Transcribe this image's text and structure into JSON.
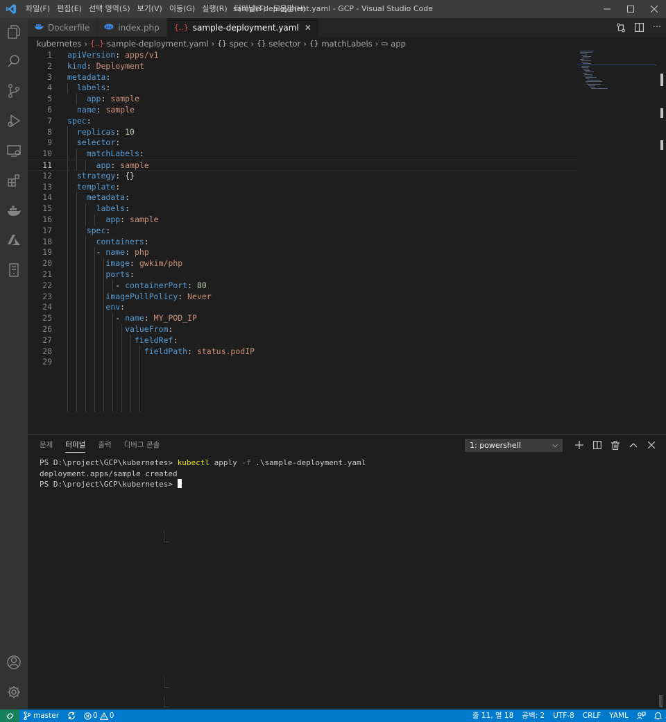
{
  "titlebar": {
    "menu": [
      "파일(F)",
      "편집(E)",
      "선택 영역(S)",
      "보기(V)",
      "이동(G)",
      "실행(R)",
      "터미널(T)",
      "도움말(H)"
    ],
    "title": "sample-deployment.yaml - GCP - Visual Studio Code"
  },
  "tabs": [
    {
      "label": "Dockerfile",
      "icon": "docker-icon",
      "active": false
    },
    {
      "label": "index.php",
      "icon": "php-icon",
      "active": false
    },
    {
      "label": "sample-deployment.yaml",
      "icon": "yaml-icon",
      "active": true
    }
  ],
  "breadcrumb": [
    "kubernetes",
    "sample-deployment.yaml",
    "spec",
    "selector",
    "matchLabels",
    "app"
  ],
  "editor": {
    "current_line": 11,
    "lines": [
      "1",
      "2",
      "3",
      "4",
      "5",
      "6",
      "7",
      "8",
      "9",
      "10",
      "11",
      "12",
      "13",
      "14",
      "15",
      "16",
      "17",
      "18",
      "19",
      "20",
      "21",
      "22",
      "23",
      "24",
      "25",
      "26",
      "27",
      "28",
      "29"
    ],
    "code": {
      "l1": {
        "key": "apiVersion",
        "val": "apps/v1"
      },
      "l2": {
        "key": "kind",
        "val": "Deployment"
      },
      "l3": {
        "key": "metadata"
      },
      "l4": {
        "key": "labels"
      },
      "l5": {
        "key": "app",
        "val": "sample"
      },
      "l6": {
        "key": "name",
        "val": "sample"
      },
      "l7": {
        "key": "spec"
      },
      "l8": {
        "key": "replicas",
        "val": "10"
      },
      "l9": {
        "key": "selector"
      },
      "l10": {
        "key": "matchLabels"
      },
      "l11": {
        "key": "app",
        "val": "sample"
      },
      "l12": {
        "key": "strategy",
        "val": "{}"
      },
      "l13": {
        "key": "template"
      },
      "l14": {
        "key": "metadata"
      },
      "l15": {
        "key": "labels"
      },
      "l16": {
        "key": "app",
        "val": "sample"
      },
      "l17": {
        "key": "spec"
      },
      "l18": {
        "key": "containers"
      },
      "l19": {
        "key": "name",
        "val": "php"
      },
      "l20": {
        "key": "image",
        "val": "gwkim/php"
      },
      "l21": {
        "key": "ports"
      },
      "l22": {
        "key": "containerPort",
        "val": "80"
      },
      "l23": {
        "key": "imagePullPolicy",
        "val": "Never"
      },
      "l24": {
        "key": "env"
      },
      "l25": {
        "key": "name",
        "val": "MY_POD_IP"
      },
      "l26": {
        "key": "valueFrom"
      },
      "l27": {
        "key": "fieldRef"
      },
      "l28": {
        "key": "fieldPath",
        "val": "status.podIP"
      }
    }
  },
  "panel": {
    "tabs": [
      "문제",
      "터미널",
      "출력",
      "디버그 콘솔"
    ],
    "active_tab": "터미널",
    "terminal_select": "1: powershell",
    "terminal": {
      "prompt1": "PS D:\\project\\GCP\\kubernetes> ",
      "cmd": "kubectl",
      "arg1": " apply ",
      "flag": "-f",
      "arg2": " .\\sample-deployment.yaml",
      "output": "deployment.apps/sample created",
      "prompt2": "PS D:\\project\\GCP\\kubernetes> "
    }
  },
  "statusbar": {
    "branch": "master",
    "errors": "0",
    "warnings": "0",
    "position": "줄 11, 열 18",
    "spaces": "공백: 2",
    "encoding": "UTF-8",
    "eol": "CRLF",
    "language": "YAML"
  },
  "colors": {
    "statusbar": "#007acc",
    "keyword": "#569cd6",
    "string": "#ce9178",
    "number": "#b5cea8"
  }
}
